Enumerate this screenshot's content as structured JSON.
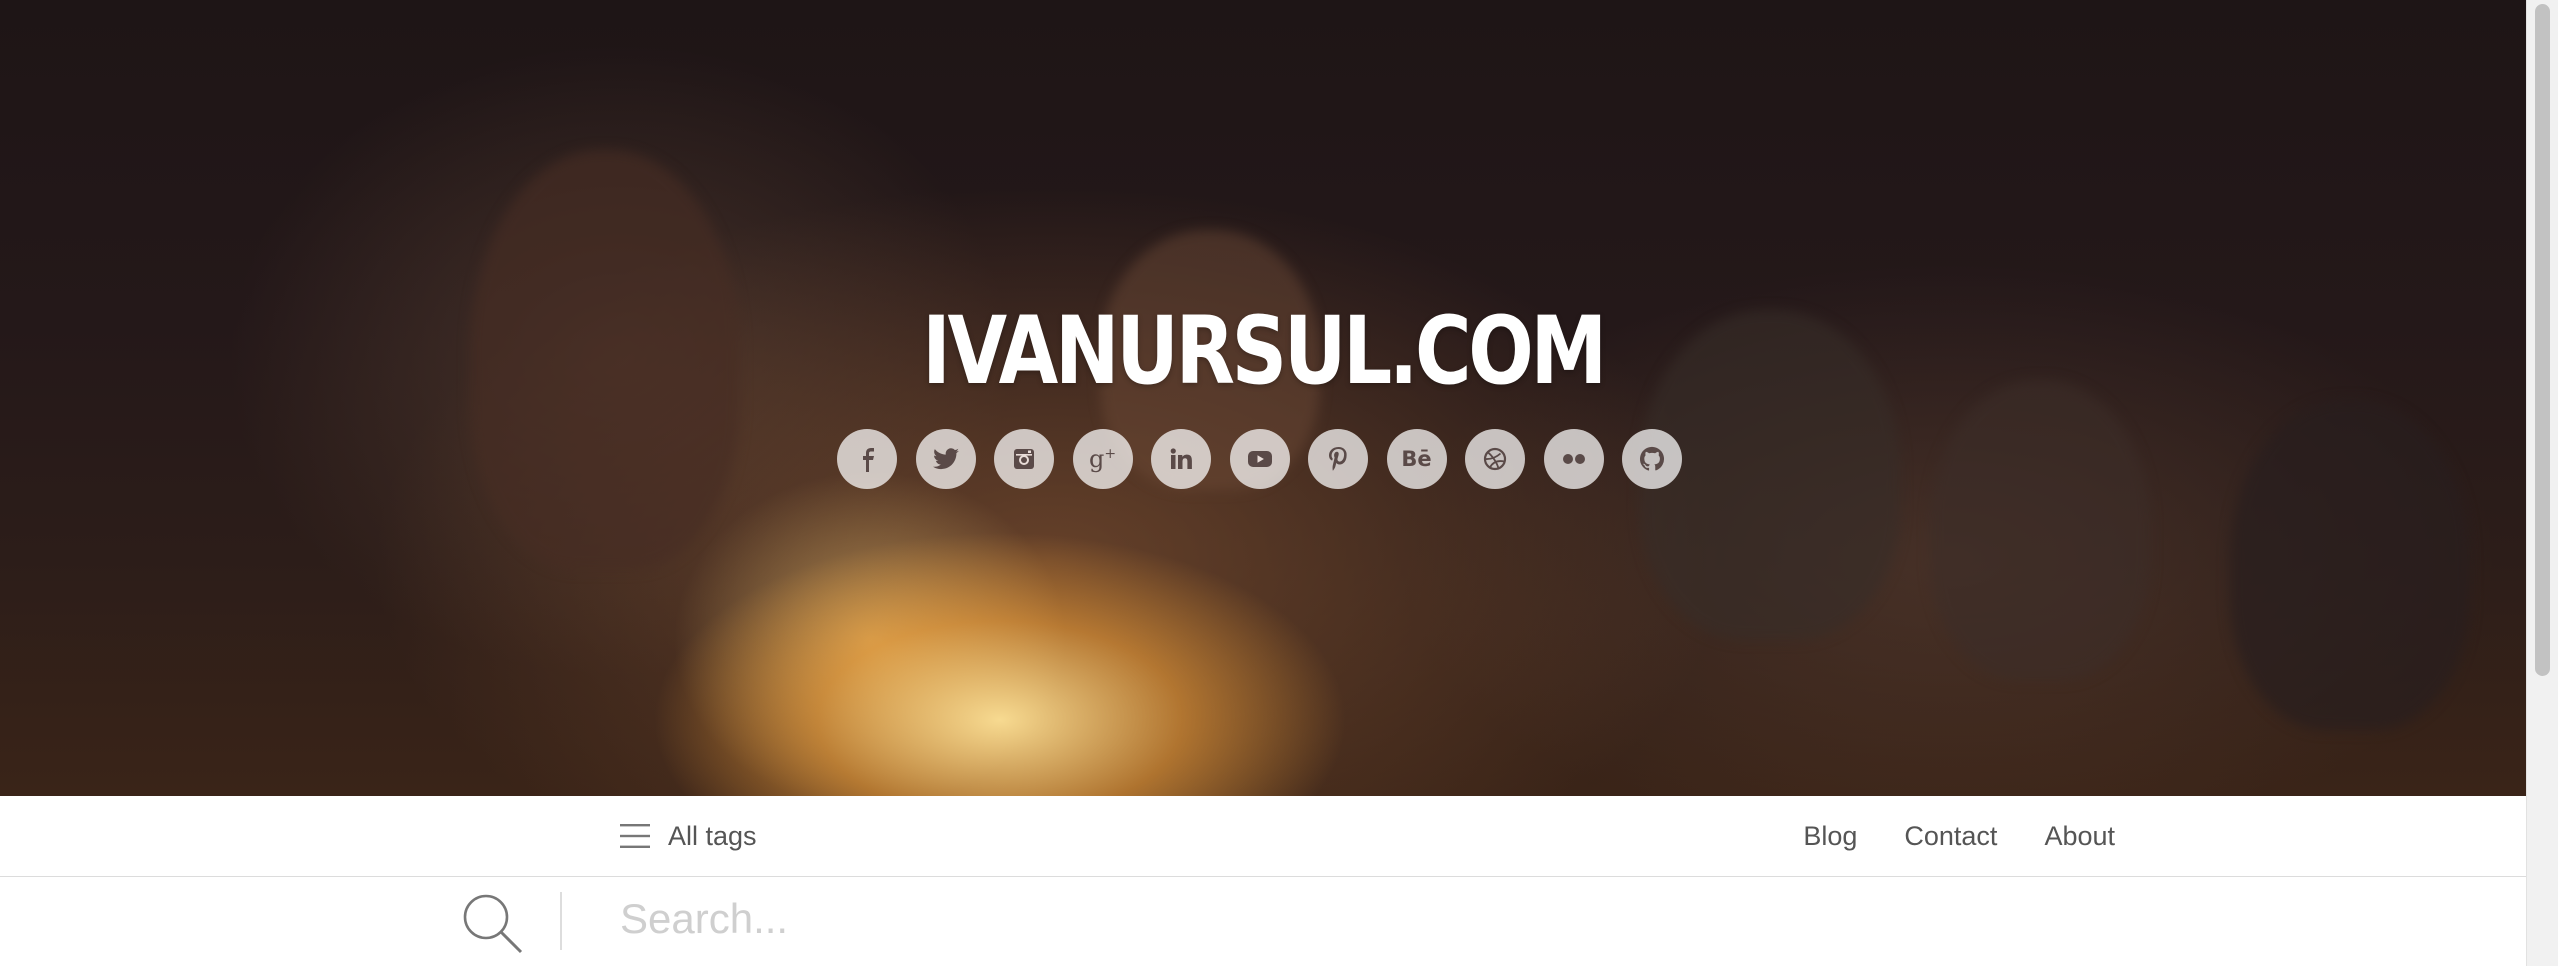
{
  "site_title": "IVANURSUL.COM",
  "social_links": [
    {
      "name": "facebook-icon",
      "glyph": "f"
    },
    {
      "name": "twitter-icon",
      "glyph": "twitter"
    },
    {
      "name": "instagram-icon",
      "glyph": "instagram"
    },
    {
      "name": "google-plus-icon",
      "glyph": "g+"
    },
    {
      "name": "linkedin-icon",
      "glyph": "in"
    },
    {
      "name": "youtube-icon",
      "glyph": "youtube"
    },
    {
      "name": "pinterest-icon",
      "glyph": "p"
    },
    {
      "name": "behance-icon",
      "glyph": "Bē"
    },
    {
      "name": "dribbble-icon",
      "glyph": "dribbble"
    },
    {
      "name": "flickr-icon",
      "glyph": "flickr"
    },
    {
      "name": "github-icon",
      "glyph": "github"
    }
  ],
  "nav": {
    "tags_label": "All tags",
    "links": [
      "Blog",
      "Contact",
      "About"
    ]
  },
  "search": {
    "placeholder": "Search...",
    "value": ""
  },
  "colors": {
    "icon_bg": "#ffffffb8",
    "icon_fg": "#5a4a48",
    "nav_text": "#555555",
    "placeholder": "#cfcfcf"
  }
}
